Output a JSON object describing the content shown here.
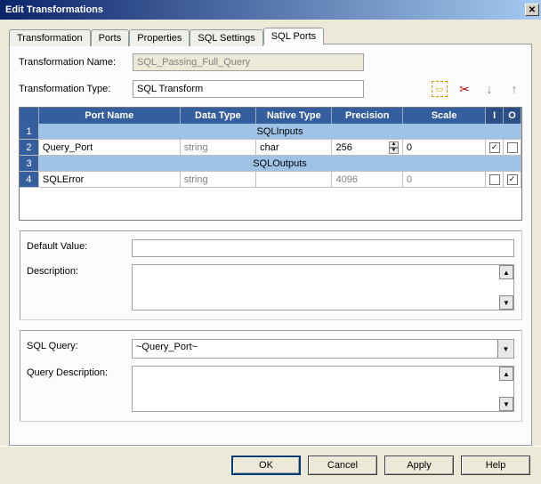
{
  "window": {
    "title": "Edit Transformations"
  },
  "tabs": [
    "Transformation",
    "Ports",
    "Properties",
    "SQL Settings",
    "SQL Ports"
  ],
  "active_tab": 4,
  "form": {
    "name_label": "Transformation Name:",
    "name_value": "SQL_Passing_Full_Query",
    "type_label": "Transformation Type:",
    "type_value": "SQL Transform"
  },
  "grid": {
    "headers": {
      "port": "Port Name",
      "dtype": "Data Type",
      "ntype": "Native Type",
      "prec": "Precision",
      "scale": "Scale",
      "i": "I",
      "o": "O"
    },
    "rows": [
      {
        "n": "1",
        "section": "SQLInputs"
      },
      {
        "n": "2",
        "port": "Query_Port",
        "dtype": "string",
        "ntype": "char",
        "prec": "256",
        "scale": "0",
        "i": true,
        "o": false,
        "spin": true,
        "disabled": false
      },
      {
        "n": "3",
        "section": "SQLOutputs"
      },
      {
        "n": "4",
        "port": "SQLError",
        "dtype": "string",
        "ntype": "",
        "prec": "4096",
        "scale": "0",
        "i": false,
        "o": true,
        "spin": false,
        "disabled": true
      }
    ]
  },
  "group1": {
    "default_label": "Default Value:",
    "default_value": "",
    "desc_label": "Description:",
    "desc_value": ""
  },
  "group2": {
    "sql_label": "SQL Query:",
    "sql_value": "~Query_Port~",
    "qdesc_label": "Query Description:",
    "qdesc_value": ""
  },
  "buttons": {
    "ok": "OK",
    "cancel": "Cancel",
    "apply": "Apply",
    "help": "Help"
  }
}
